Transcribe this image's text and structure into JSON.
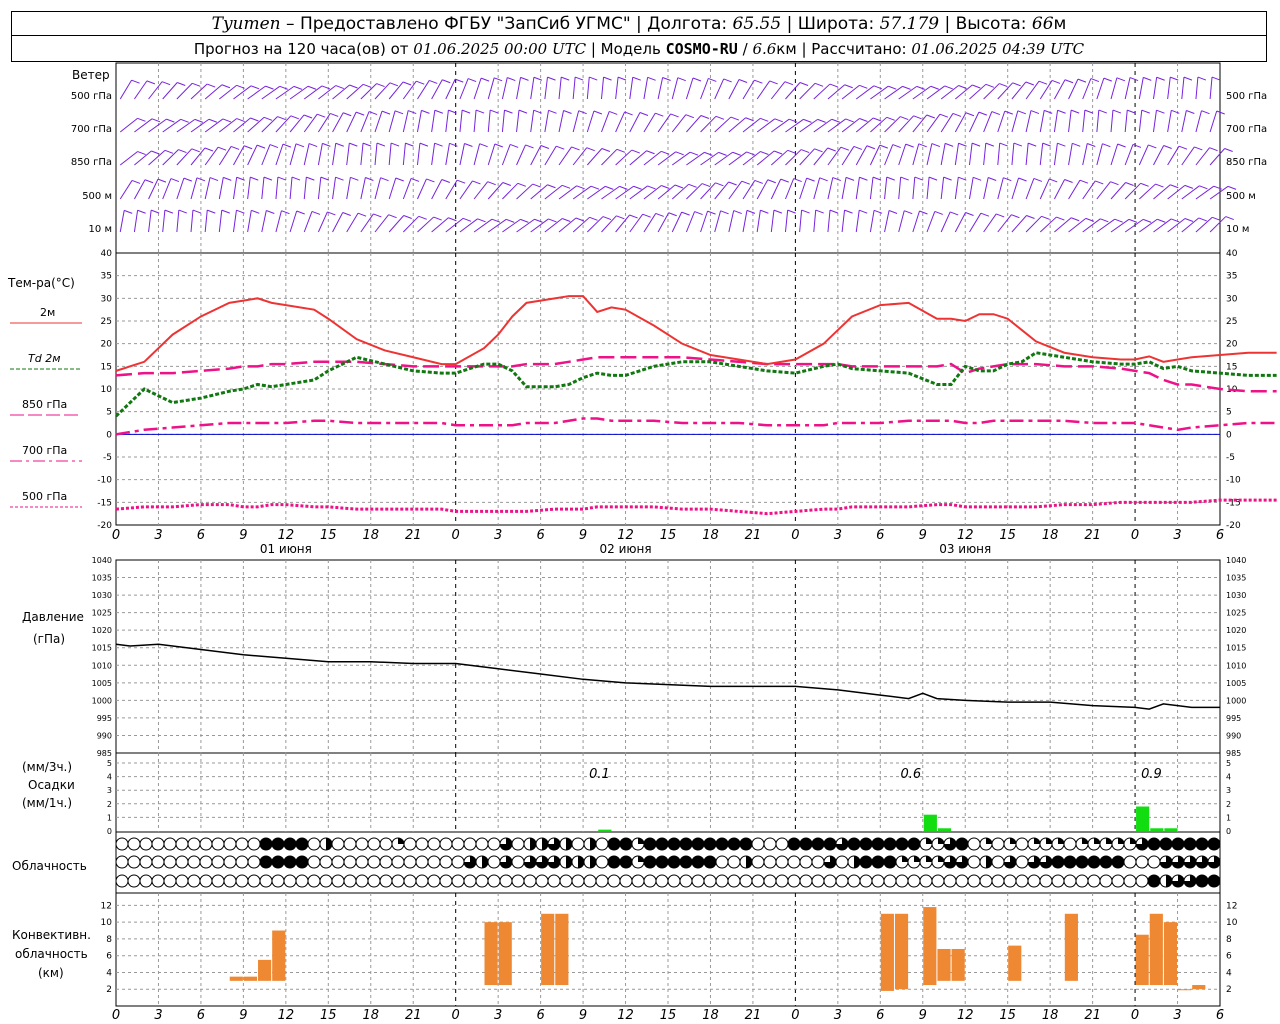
{
  "header": {
    "station": "Tyumen",
    "provider": " – Предоставлено ФГБУ \"ЗапСиб УГМС\" | Долгота: ",
    "lon": "65.55",
    "lat_label": " | Широта: ",
    "lat": "57.179",
    "alt_label": " | Высота: ",
    "alt": "66",
    "alt_unit": "м",
    "forecast_label": "Прогноз на 120 часа(ов) от ",
    "forecast_time": "01.06.2025 00:00 UTC",
    "model_label": " | Модель ",
    "model": "COSMO-RU",
    "res_sep": " / ",
    "res": "6.6",
    "res_unit": "км | Рассчитано: ",
    "calc_time": "01.06.2025 04:39 UTC"
  },
  "wind_panel": {
    "title": "Ветер",
    "levels": [
      "500 гПа",
      "700 гПа",
      "850 гПа",
      "500 м",
      "10 м"
    ]
  },
  "temp_panel": {
    "title": "Тем-ра(°C)",
    "legend": [
      "2м",
      "Td  2м",
      "850 гПа",
      "700 гПа",
      "500 гПа"
    ],
    "colors": {
      "t2m": "#ee3333",
      "td": "#117711",
      "p850": "#ee1188",
      "p700": "#ee1188",
      "p500": "#ee1188",
      "zero": "#0000cc"
    }
  },
  "x_axis": {
    "hours": [
      "0",
      "3",
      "6",
      "9",
      "12",
      "15",
      "18",
      "21",
      "0",
      "3",
      "6",
      "9",
      "12",
      "15",
      "18",
      "21",
      "0",
      "3",
      "6",
      "9",
      "12",
      "15",
      "18",
      "21",
      "0",
      "3",
      "6"
    ],
    "days": [
      "01 июня",
      "02 июня",
      "03 июня"
    ]
  },
  "pressure_panel": {
    "title": "Давление",
    "unit": "(гПа)"
  },
  "precip_panel": {
    "unit3": "(мм/3ч.)",
    "title": "Осадки",
    "unit1": "(мм/1ч.)",
    "totals": [
      "0.1",
      "0.6",
      "0.9"
    ]
  },
  "cloud_panel": {
    "title": "Облачность"
  },
  "conv_panel": {
    "title1": "Конвективн.",
    "title2": "облачность",
    "unit": "(км)"
  },
  "chart_data": [
    {
      "type": "line",
      "title": "Тем-ра(°C)",
      "ylim": [
        -20,
        40
      ],
      "x_hours": [
        0,
        2,
        4,
        6,
        8,
        9,
        10,
        11,
        12,
        14,
        15,
        17,
        19,
        21,
        23,
        24,
        26,
        27,
        28,
        29,
        31,
        32,
        33,
        34,
        35,
        36,
        38,
        40,
        42,
        44,
        46,
        48,
        50,
        51,
        52,
        54,
        56,
        58,
        59,
        60,
        61,
        62,
        63,
        64,
        65,
        67,
        69,
        71,
        72,
        73,
        74,
        75,
        76,
        78,
        80,
        82
      ],
      "t2m": [
        14,
        16,
        22,
        26,
        29,
        29.5,
        30,
        29,
        28.5,
        27.5,
        25.5,
        21,
        18.5,
        17,
        15.5,
        15.5,
        19,
        22,
        26,
        29,
        30,
        30.5,
        30.5,
        27,
        28,
        27.5,
        24,
        20,
        17.5,
        16.5,
        15.5,
        16.5,
        20,
        23,
        26,
        28.5,
        29,
        25.5,
        25.5,
        25,
        26.5,
        26.5,
        25.5,
        23,
        20.5,
        18,
        17,
        16.5,
        16.5,
        17.2,
        16,
        16.5,
        17,
        17.5,
        18,
        18
      ],
      "td2m": [
        4,
        10,
        7,
        8,
        9.5,
        10,
        11,
        10.5,
        11,
        12,
        14,
        17,
        15.5,
        14,
        13.5,
        13.5,
        15.5,
        15.5,
        14,
        10.5,
        10.5,
        11,
        12.5,
        13.5,
        13,
        13,
        15,
        16,
        16,
        15,
        14,
        13.5,
        15,
        15.5,
        14.5,
        14,
        13.5,
        11,
        11,
        15,
        14,
        14,
        15.5,
        16,
        18,
        17,
        16,
        15.5,
        15.5,
        16,
        14.5,
        15,
        14,
        13.5,
        13,
        13
      ],
      "t850": [
        13,
        13.5,
        13.5,
        14,
        14.5,
        15,
        15,
        15.5,
        15.5,
        16,
        16,
        16,
        15.5,
        15,
        15,
        15,
        15,
        15,
        15,
        15.5,
        15.5,
        16,
        16.5,
        17,
        17,
        17,
        17,
        17,
        16.5,
        16,
        15.5,
        15.5,
        15.5,
        15.5,
        15,
        15,
        15,
        15,
        15.5,
        13.5,
        14.5,
        15,
        15.5,
        15.5,
        15.5,
        15,
        15,
        14.5,
        14,
        13.5,
        12,
        11,
        11,
        10,
        9.5,
        9.5
      ],
      "t700": [
        0,
        1,
        1.5,
        2,
        2.5,
        2.5,
        2.5,
        2.5,
        2.5,
        3,
        3,
        2.5,
        2.5,
        2.5,
        2.5,
        2,
        2,
        2,
        2,
        2.5,
        2.5,
        3,
        3.5,
        3.5,
        3,
        3,
        3,
        2.5,
        2.5,
        2.5,
        2,
        2,
        2,
        2.5,
        2.5,
        2.5,
        3,
        3,
        3,
        2.5,
        2.5,
        3,
        3,
        3,
        3,
        3,
        2.5,
        2.5,
        2.5,
        2,
        1.5,
        1,
        1.5,
        2,
        2.5,
        2.5
      ],
      "t500": [
        -16.5,
        -16,
        -16,
        -15.5,
        -15.5,
        -16,
        -16,
        -15.5,
        -15.5,
        -16,
        -16,
        -16.5,
        -16.5,
        -16.5,
        -16.5,
        -17,
        -17,
        -17,
        -17,
        -17,
        -16.5,
        -16.5,
        -16.5,
        -16,
        -16,
        -16,
        -16,
        -16.5,
        -16.5,
        -17,
        -17.5,
        -17,
        -16.5,
        -16.5,
        -16,
        -16,
        -16,
        -15.5,
        -15.5,
        -16,
        -16,
        -16,
        -16,
        -16,
        -16,
        -15.5,
        -15.5,
        -15,
        -15,
        -15,
        -15,
        -15,
        -15,
        -14.5,
        -14.5,
        -14.5
      ]
    },
    {
      "type": "line",
      "title": "Давление",
      "ylabel": "(гПа)",
      "ylim": [
        985,
        1040
      ],
      "x_hours": [
        0,
        1,
        3,
        6,
        9,
        12,
        15,
        18,
        21,
        24,
        27,
        30,
        33,
        36,
        39,
        42,
        45,
        48,
        51,
        54,
        56,
        57,
        58,
        60,
        63,
        66,
        69,
        72,
        73,
        74,
        76,
        78
      ],
      "values": [
        1016,
        1015.5,
        1016,
        1014.5,
        1013,
        1012,
        1011,
        1011,
        1010.5,
        1010.5,
        1009,
        1007.5,
        1006,
        1005,
        1004.5,
        1004,
        1004,
        1004,
        1003,
        1001.5,
        1000.5,
        1002,
        1000.5,
        1000,
        999.5,
        999.5,
        998.5,
        998,
        997.5,
        999,
        998,
        998
      ]
    },
    {
      "type": "bar",
      "title": "Осадки",
      "ylabel": "(мм/3ч.)",
      "ylim": [
        0,
        5
      ],
      "x_hours": [
        34,
        57,
        58,
        72,
        73,
        74
      ],
      "values": [
        0.05,
        0.6,
        0.1,
        0.9,
        0.1,
        0.1
      ],
      "totals": [
        0.1,
        0.6,
        0.9
      ]
    },
    {
      "type": "table",
      "title": "Облачность",
      "note": "0=ясно, 1=1/4, 2=1/2, 3=3/4, 4=сплошная",
      "high": [
        0,
        0,
        0,
        0,
        0,
        0,
        0,
        0,
        0,
        0,
        0,
        0,
        4,
        4,
        4,
        4,
        0,
        2,
        0,
        0,
        0,
        0,
        0,
        1,
        0,
        0,
        0,
        0,
        0,
        0,
        0,
        0,
        3,
        0,
        2,
        2,
        3,
        2,
        0,
        2,
        0,
        4,
        4,
        1,
        4,
        4,
        4,
        4,
        4,
        4,
        4,
        4,
        4,
        0,
        0,
        0,
        4,
        4,
        4,
        4,
        3,
        4,
        4,
        4,
        4,
        4,
        4,
        1,
        1,
        3,
        4,
        0,
        1,
        0,
        1,
        0,
        1,
        1,
        1,
        0,
        1,
        1,
        1,
        1,
        1,
        3,
        4,
        4,
        4,
        4,
        4,
        4
      ],
      "mid": [
        0,
        0,
        0,
        0,
        0,
        0,
        0,
        0,
        0,
        0,
        0,
        0,
        4,
        4,
        4,
        4,
        0,
        0,
        0,
        0,
        0,
        0,
        0,
        0,
        0,
        0,
        0,
        0,
        0,
        3,
        2,
        0,
        3,
        0,
        3,
        3,
        3,
        2,
        2,
        2,
        0,
        4,
        4,
        1,
        4,
        4,
        4,
        4,
        4,
        4,
        0,
        0,
        2,
        0,
        0,
        0,
        0,
        0,
        0,
        3,
        0,
        2,
        4,
        4,
        4,
        1,
        1,
        1,
        1,
        3,
        3,
        0,
        2,
        0,
        3,
        0,
        3,
        3,
        4,
        4,
        4,
        4,
        4,
        4,
        0,
        0,
        0,
        3,
        3,
        3,
        3,
        3
      ],
      "low": [
        0,
        0,
        0,
        0,
        0,
        0,
        0,
        0,
        0,
        0,
        0,
        0,
        0,
        0,
        0,
        0,
        0,
        0,
        0,
        0,
        0,
        0,
        0,
        0,
        0,
        0,
        0,
        0,
        0,
        0,
        0,
        0,
        0,
        0,
        0,
        0,
        0,
        0,
        0,
        0,
        0,
        0,
        0,
        0,
        0,
        0,
        0,
        0,
        0,
        0,
        0,
        0,
        0,
        0,
        0,
        0,
        0,
        0,
        0,
        0,
        0,
        0,
        0,
        0,
        0,
        0,
        0,
        0,
        0,
        0,
        0,
        0,
        0,
        0,
        0,
        0,
        0,
        0,
        0,
        0,
        0,
        0,
        0,
        0,
        0,
        0,
        4,
        2,
        3,
        3,
        4,
        4
      ]
    },
    {
      "type": "bar",
      "title": "Конвективн. облачность",
      "ylabel": "(км)",
      "ylim": [
        0,
        13
      ],
      "x_hours": [
        8,
        9,
        10,
        11,
        26,
        27,
        30,
        31,
        54,
        55,
        57,
        58,
        59,
        63,
        67,
        72,
        73,
        74,
        75,
        76
      ],
      "base": [
        3,
        3,
        3,
        3,
        2.5,
        2.5,
        2.5,
        2.5,
        1.8,
        2,
        2.5,
        3,
        3,
        3,
        3,
        2.5,
        2.5,
        2.5,
        2,
        2
      ],
      "top": [
        3.5,
        3.5,
        5.5,
        9,
        10,
        10,
        11,
        11,
        11,
        11,
        11.8,
        6.8,
        6.8,
        7.2,
        11,
        8.5,
        11,
        10,
        2,
        2.5
      ]
    }
  ]
}
